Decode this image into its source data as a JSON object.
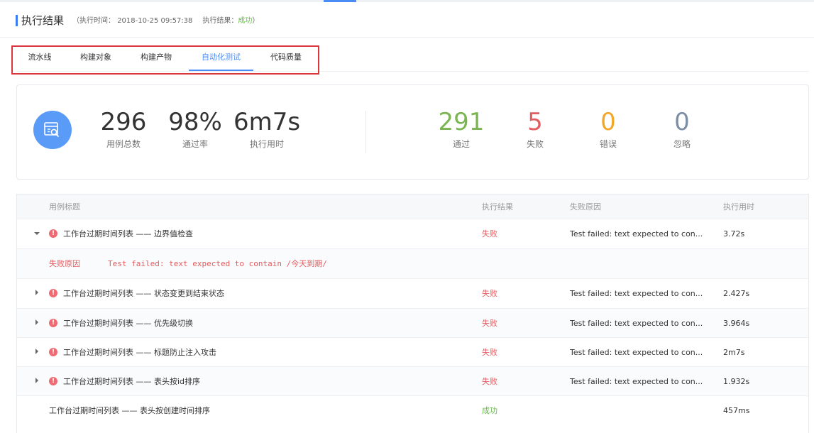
{
  "header": {
    "title": "执行结果",
    "time_label": "（执行时间：",
    "time_value": "2018-10-25 09:57:38",
    "result_label": "执行结果：",
    "result_value": "成功",
    "close_paren": "）"
  },
  "tabs": [
    {
      "label": "流水线",
      "active": false
    },
    {
      "label": "构建对象",
      "active": false
    },
    {
      "label": "构建产物",
      "active": false
    },
    {
      "label": "自动化测试",
      "active": true
    },
    {
      "label": "代码质量",
      "active": false
    }
  ],
  "summary": {
    "icon": "search-report-icon",
    "total": {
      "value": "296",
      "label": "用例总数"
    },
    "pass_rate": {
      "value": "98%",
      "label": "通过率"
    },
    "duration": {
      "value": "6m7s",
      "label": "执行用时"
    },
    "passed": {
      "value": "291",
      "label": "通过"
    },
    "failed": {
      "value": "5",
      "label": "失败"
    },
    "errors": {
      "value": "0",
      "label": "错误"
    },
    "ignored": {
      "value": "0",
      "label": "忽略"
    }
  },
  "table": {
    "columns": {
      "title": "用例标题",
      "result": "执行结果",
      "reason": "失败原因",
      "time": "执行用时"
    },
    "rows": [
      {
        "title": "工作台过期时间列表 —— 边界值检查",
        "result": "失败",
        "reason": "Test failed: text expected to con...",
        "time": "3.72s"
      },
      {
        "title": "工作台过期时间列表 —— 状态变更到结束状态",
        "result": "失败",
        "reason": "Test failed: text expected to con...",
        "time": "2.427s"
      },
      {
        "title": "工作台过期时间列表 —— 优先级切换",
        "result": "失败",
        "reason": "Test failed: text expected to con...",
        "time": "3.964s"
      },
      {
        "title": "工作台过期时间列表 —— 标题防止注入攻击",
        "result": "失败",
        "reason": "Test failed: text expected to con...",
        "time": "2m7s"
      },
      {
        "title": "工作台过期时间列表 —— 表头按id排序",
        "result": "失败",
        "reason": "Test failed: text expected to con...",
        "time": "1.932s"
      },
      {
        "title": "工作台过期时间列表 —— 表头按创建时间排序",
        "result": "成功",
        "reason": "",
        "time": "457ms"
      }
    ],
    "expanded_detail": {
      "label": "失败原因",
      "message": "Test failed: text expected to contain /今天到期/"
    }
  },
  "colors": {
    "accent": "#4a8bf5",
    "pass": "#7bb552",
    "fail": "#e15d61",
    "error": "#f2a726",
    "ignored": "#7b8ea5"
  }
}
